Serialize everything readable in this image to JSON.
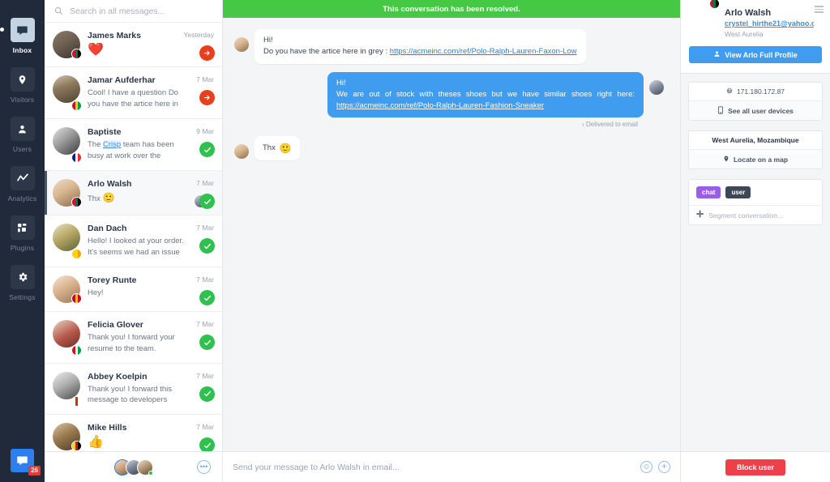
{
  "nav": {
    "items": [
      {
        "label": "Inbox",
        "icon": "inbox-icon",
        "active": true
      },
      {
        "label": "Visitors",
        "icon": "pin-icon",
        "active": false
      },
      {
        "label": "Users",
        "icon": "user-icon",
        "active": false
      },
      {
        "label": "Analytics",
        "icon": "chart-icon",
        "active": false
      },
      {
        "label": "Plugins",
        "icon": "plugins-icon",
        "active": false
      },
      {
        "label": "Settings",
        "icon": "gear-icon",
        "active": false
      }
    ],
    "bottom": {
      "icon": "chat-bubble-icon",
      "badge": "26"
    }
  },
  "search": {
    "placeholder": "Search in all messages...",
    "value": "",
    "icon": "search-icon"
  },
  "conversations": [
    {
      "name": "James Marks",
      "preview": "",
      "emoji": "❤️",
      "time": "Yesterday",
      "status": "pending",
      "avatar": "f1",
      "flag": [
        "#d21034",
        "#007a3d",
        "#000000"
      ]
    },
    {
      "name": "Jamar Aufderhar",
      "preview": "Cool! I have a question Do you have the artice here in grey :",
      "emoji": "",
      "time": "7 Mar",
      "status": "pending",
      "avatar": "f2",
      "flag": [
        "#ce1126",
        "#fcd116",
        "#009e49"
      ]
    },
    {
      "name": "Baptiste",
      "preview": "The Crisp team has been busy at work over the months of",
      "link_word": "Crisp",
      "emoji": "",
      "time": "9 Mar",
      "status": "resolved",
      "avatar": "f3",
      "flag": [
        "#002395",
        "#ffffff",
        "#ed2939"
      ]
    },
    {
      "name": "Arlo Walsh",
      "preview": "Thx",
      "emoji": "🙂",
      "time": "7 Mar",
      "status": "resolved",
      "avatar": "f4",
      "selected": true,
      "mini_avatar": "f13",
      "flag": [
        "#d21034",
        "#007a3d",
        "#000000"
      ]
    },
    {
      "name": "Dan Dach",
      "preview": "Hello! I looked at your order. It's seems we had an issue with USPS.",
      "emoji": "",
      "time": "7 Mar",
      "status": "resolved",
      "avatar": "f5",
      "flag": [
        "#fcd116",
        "#fcd116",
        "#fcd116"
      ]
    },
    {
      "name": "Torey Runte",
      "preview": "Hey!",
      "emoji": "",
      "time": "7 Mar",
      "status": "resolved",
      "avatar": "f6",
      "flag": [
        "#c60b1e",
        "#ffc400",
        "#c60b1e"
      ]
    },
    {
      "name": "Felicia Glover",
      "preview": "Thank you! I forward your resume to the team.",
      "emoji": "",
      "time": "7 Mar",
      "status": "resolved",
      "avatar": "f7",
      "flag": [
        "#e30a17",
        "#ffffff",
        "#009e49"
      ]
    },
    {
      "name": "Abbey Koelpin",
      "preview": "Thank you! I forward this message to developers",
      "emoji": "",
      "time": "7 Mar",
      "status": "resolved",
      "avatar": "f8",
      "flag": [
        "#ffffff",
        "#d52b1e",
        "#ffffff"
      ]
    },
    {
      "name": "Mike Hills",
      "preview": "",
      "emoji": "👍",
      "time": "7 Mar",
      "status": "resolved",
      "avatar": "f9",
      "flag": [
        "#fcd116",
        "#d21034",
        "#000000"
      ]
    }
  ],
  "operators": {
    "avatars": [
      "f10",
      "f11",
      "f12"
    ],
    "more_icon": "ellipsis-icon"
  },
  "chat": {
    "banner": "This conversation has been resolved.",
    "messages": [
      {
        "direction": "in",
        "avatar": "f4",
        "line1": "Hi!",
        "line2_prefix": "Do you have the artice here in grey : ",
        "link": "https://acmeinc.com/ref/Polo-Ralph-Lauren-Faxon-Low"
      },
      {
        "direction": "out",
        "avatar": "f13",
        "line1": "Hi!",
        "line2_prefix": "We are out of stock with theses shoes but we have similar shoes right here: ",
        "link": "https://acmeinc.com/ref/Polo-Ralph-Lauren-Fashion-Sneaker",
        "meta": "Delivered to email"
      },
      {
        "direction": "in",
        "avatar": "f4",
        "text": "Thx",
        "emoji": "🙂"
      }
    ],
    "composer": {
      "placeholder": "Send your message to Arlo Walsh in email...",
      "value": "",
      "icons": [
        "emoji-icon",
        "plus-icon"
      ]
    }
  },
  "sidebar": {
    "menu_icon": "hamburger-icon",
    "user": {
      "name": "Arlo Walsh",
      "email": "crystel_hirthe21@yahoo.c",
      "city": "West Aurelia",
      "avatar": "f4",
      "flag": [
        "#d21034",
        "#007a3d",
        "#000000"
      ]
    },
    "profile_button": {
      "label": "View Arlo Full Profile",
      "icon": "user-icon"
    },
    "device_card": {
      "ip": "171.180.172.87",
      "ip_icon": "help-icon",
      "devices_label": "See all user devices",
      "devices_icon": "phone-icon"
    },
    "location_card": {
      "place": "West Aurelia, Mozambique",
      "locate_label": "Locate on a map",
      "locate_icon": "pin-icon"
    },
    "tags": [
      {
        "label": "chat",
        "color": "#9b5de5"
      },
      {
        "label": "user",
        "color": "#3d4756"
      }
    ],
    "segment_placeholder": "Segment conversation...",
    "segment_icon": "plus-icon",
    "block_button": "Block user"
  },
  "colors": {
    "accent_blue": "#3f9cef",
    "resolved_green": "#45c945",
    "pending_red": "#e8401f",
    "block_red": "#ef404a",
    "nav_dark": "#202a3b"
  }
}
